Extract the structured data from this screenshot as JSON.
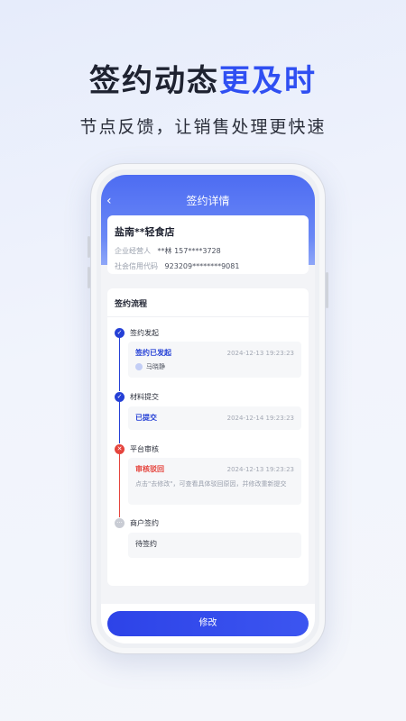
{
  "promo": {
    "headline_part1": "签约动态",
    "headline_part2": "更及时",
    "subheadline": "节点反馈，让销售处理更快速"
  },
  "app": {
    "nav_title": "签约详情",
    "back_icon": "chevron-left-icon",
    "store": {
      "name": "盐南**轻食店",
      "operator_label": "企业经营人",
      "operator_value": "**林 157****3728",
      "credit_label": "社会信用代码",
      "credit_value": "923209********9081"
    },
    "flow": {
      "title": "签约流程",
      "steps": [
        {
          "label": "签约发起",
          "status": "签约已发起",
          "time": "2024-12-13 19:23:23",
          "person": "马晓静",
          "icon": "check-icon",
          "color": "#2540d6",
          "status_color": "#2540d6"
        },
        {
          "label": "材料提交",
          "status": "已提交",
          "time": "2024-12-14 19:23:23",
          "icon": "check-icon",
          "color": "#2540d6",
          "status_color": "#2540d6"
        },
        {
          "label": "平台审核",
          "status": "审核驳回",
          "time": "2024-12-13 19:23:23",
          "note": "点击\"去修改\"，可查看具体驳回原因，并修改重新提交",
          "icon": "close-icon",
          "color": "#e5443d",
          "status_color": "#e5443d"
        },
        {
          "label": "商户签约",
          "status": "待签约",
          "icon": "more-icon",
          "color": "#c9ccd4",
          "status_color": "#2a2e3a"
        }
      ]
    },
    "submit_label": "修改"
  }
}
